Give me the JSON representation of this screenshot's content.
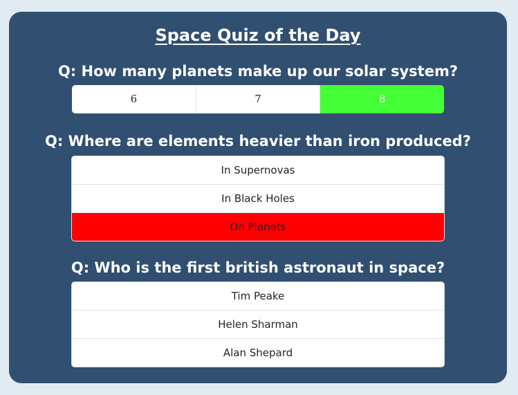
{
  "title": "Space Quiz of the Day",
  "colors": {
    "background": "#e1ecf2",
    "card": "#304f71",
    "correct": "#45ff36",
    "wrong": "#ff0000"
  },
  "questions": [
    {
      "text": "Q: How many planets make up our solar system?",
      "options": [
        {
          "label": "6",
          "state": "neutral"
        },
        {
          "label": "7",
          "state": "neutral"
        },
        {
          "label": "8",
          "state": "correct"
        }
      ]
    },
    {
      "text": "Q: Where are elements heavier than iron produced?",
      "options": [
        {
          "label": "In Supernovas",
          "state": "neutral"
        },
        {
          "label": "In Black Holes",
          "state": "neutral"
        },
        {
          "label": "On Planets",
          "state": "wrong"
        }
      ]
    },
    {
      "text": "Q: Who is the first british astronaut in space?",
      "options": [
        {
          "label": "Tim Peake",
          "state": "neutral"
        },
        {
          "label": "Helen Sharman",
          "state": "neutral"
        },
        {
          "label": "Alan Shepard",
          "state": "neutral"
        }
      ]
    }
  ]
}
